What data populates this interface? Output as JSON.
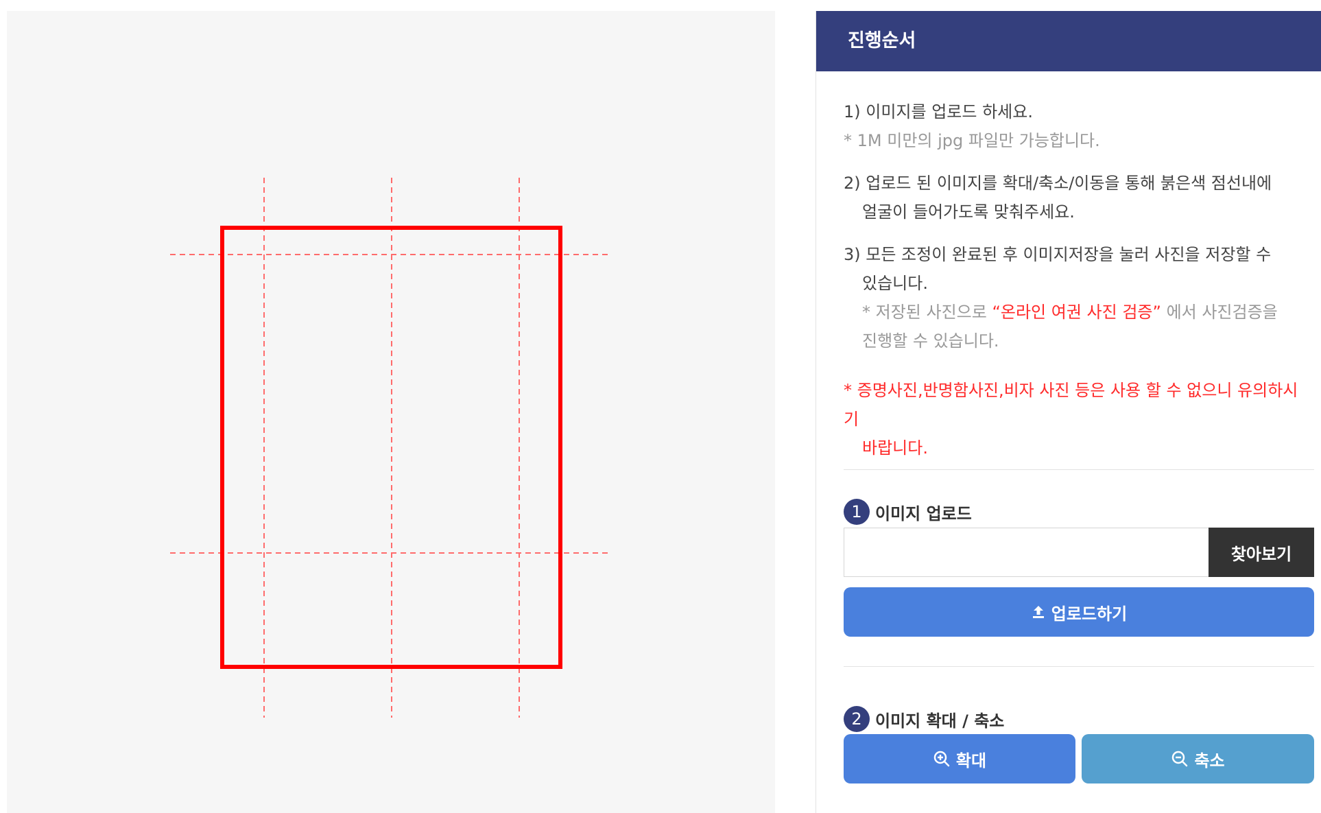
{
  "canvas": {
    "guide_color": "#ff6b6b",
    "frame_color": "#ff0000",
    "background": "#f6f6f6"
  },
  "panel": {
    "title": "진행순서",
    "header_color": "#343f7d",
    "steps": [
      {
        "line1": "1) 이미지를 업로드 하세요.",
        "note": "* 1M 미만의 jpg 파일만 가능합니다."
      },
      {
        "line1": "2) 업로드 된 이미지를 확대/축소/이동을 통해 붉은색 점선내에",
        "line2": "얼굴이 들어가도록 맞춰주세요."
      },
      {
        "line1": "3) 모든 조정이 완료된 후 이미지저장을 눌러 사진을 저장할 수",
        "line2": "있습니다.",
        "note_prefix": "* 저장된 사진으로 ",
        "note_link": "“온라인 여권 사진 검증”",
        "note_suffix": " 에서 사진검증을",
        "note_line2": "진행할 수 있습니다."
      }
    ],
    "warning_line1": "* 증명사진,반명함사진,비자 사진 등은 사용 할 수 없으니 유의하시기",
    "warning_line2": "바랍니다."
  },
  "upload_section": {
    "number": "1",
    "title": "이미지 업로드",
    "file_value": "",
    "browse_label": "찾아보기",
    "upload_label": "업로드하기",
    "upload_icon": "upload-icon"
  },
  "zoom_section": {
    "number": "2",
    "title": "이미지 확대 / 축소",
    "zoom_in_label": "확대",
    "zoom_out_label": "축소",
    "zoom_in_icon": "zoom-in-icon",
    "zoom_out_icon": "zoom-out-icon",
    "colors": {
      "zoom_in": "#4a80dd",
      "zoom_out": "#55a0cf"
    }
  }
}
